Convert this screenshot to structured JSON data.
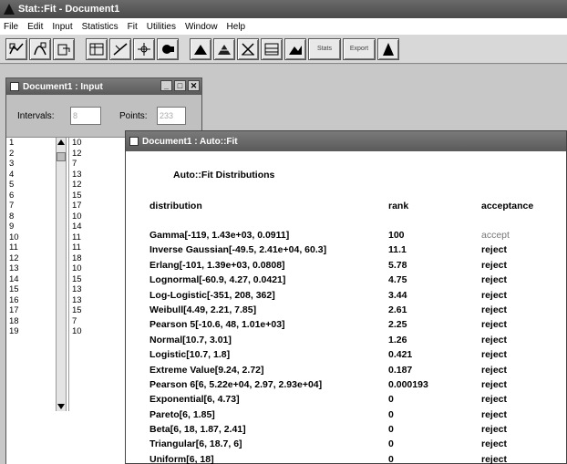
{
  "app": {
    "title": "Stat::Fit - Document1"
  },
  "menu": [
    "File",
    "Edit",
    "Input",
    "Statistics",
    "Fit",
    "Utilities",
    "Window",
    "Help"
  ],
  "toolbar": {
    "buttons": [
      "fit-icon",
      "auto-fit-icon",
      "data-icon",
      "table-icon",
      "graph-icon",
      "setup-icon",
      "chart-icon"
    ],
    "wide_buttons": [
      "Stats",
      "Export"
    ]
  },
  "input_window": {
    "title": "Document1 : Input",
    "intervals_label": "Intervals:",
    "intervals_value": "8",
    "points_label": "Points:",
    "points_value": "233",
    "rows": [
      {
        "i": "1",
        "v": "10"
      },
      {
        "i": "2",
        "v": "12"
      },
      {
        "i": "3",
        "v": "7"
      },
      {
        "i": "4",
        "v": "13"
      },
      {
        "i": "5",
        "v": "12"
      },
      {
        "i": "6",
        "v": "15"
      },
      {
        "i": "7",
        "v": "17"
      },
      {
        "i": "8",
        "v": "10"
      },
      {
        "i": "9",
        "v": "14"
      },
      {
        "i": "10",
        "v": "11"
      },
      {
        "i": "11",
        "v": "11"
      },
      {
        "i": "12",
        "v": "18"
      },
      {
        "i": "13",
        "v": "10"
      },
      {
        "i": "14",
        "v": "15"
      },
      {
        "i": "15",
        "v": "13"
      },
      {
        "i": "16",
        "v": "13"
      },
      {
        "i": "17",
        "v": "15"
      },
      {
        "i": "18",
        "v": "7"
      },
      {
        "i": "19",
        "v": "10"
      }
    ]
  },
  "autofit_window": {
    "title": "Document1 : Auto::Fit",
    "heading": "Auto::Fit Distributions",
    "headers": {
      "distribution": "distribution",
      "rank": "rank",
      "acceptance": "acceptance"
    },
    "rows": [
      {
        "d": "Gamma[-119, 1.43e+03, 0.0911]",
        "r": "100",
        "a": "accept"
      },
      {
        "d": "Inverse Gaussian[-49.5, 2.41e+04, 60.3]",
        "r": "11.1",
        "a": "reject"
      },
      {
        "d": "Erlang[-101, 1.39e+03, 0.0808]",
        "r": "5.78",
        "a": "reject"
      },
      {
        "d": "Lognormal[-60.9, 4.27, 0.0421]",
        "r": "4.75",
        "a": "reject"
      },
      {
        "d": "Log-Logistic[-351, 208, 362]",
        "r": "3.44",
        "a": "reject"
      },
      {
        "d": "Weibull[4.49, 2.21, 7.85]",
        "r": "2.61",
        "a": "reject"
      },
      {
        "d": "Pearson 5[-10.6, 48, 1.01e+03]",
        "r": "2.25",
        "a": "reject"
      },
      {
        "d": "Normal[10.7, 3.01]",
        "r": "1.26",
        "a": "reject"
      },
      {
        "d": "Logistic[10.7, 1.8]",
        "r": "0.421",
        "a": "reject"
      },
      {
        "d": "Extreme Value[9.24, 2.72]",
        "r": "0.187",
        "a": "reject"
      },
      {
        "d": "Pearson 6[6, 5.22e+04, 2.97, 2.93e+04]",
        "r": "0.000193",
        "a": "reject"
      },
      {
        "d": "Exponential[6, 4.73]",
        "r": "0",
        "a": "reject"
      },
      {
        "d": "Pareto[6, 1.85]",
        "r": "0",
        "a": "reject"
      },
      {
        "d": "Beta[6, 18, 1.87, 2.41]",
        "r": "0",
        "a": "reject"
      },
      {
        "d": "Triangular[6, 18.7, 6]",
        "r": "0",
        "a": "reject"
      },
      {
        "d": "Uniform[6, 18]",
        "r": "0",
        "a": "reject"
      }
    ]
  },
  "colors": {
    "titlebar": "#555555",
    "accept_text": "#777777"
  }
}
